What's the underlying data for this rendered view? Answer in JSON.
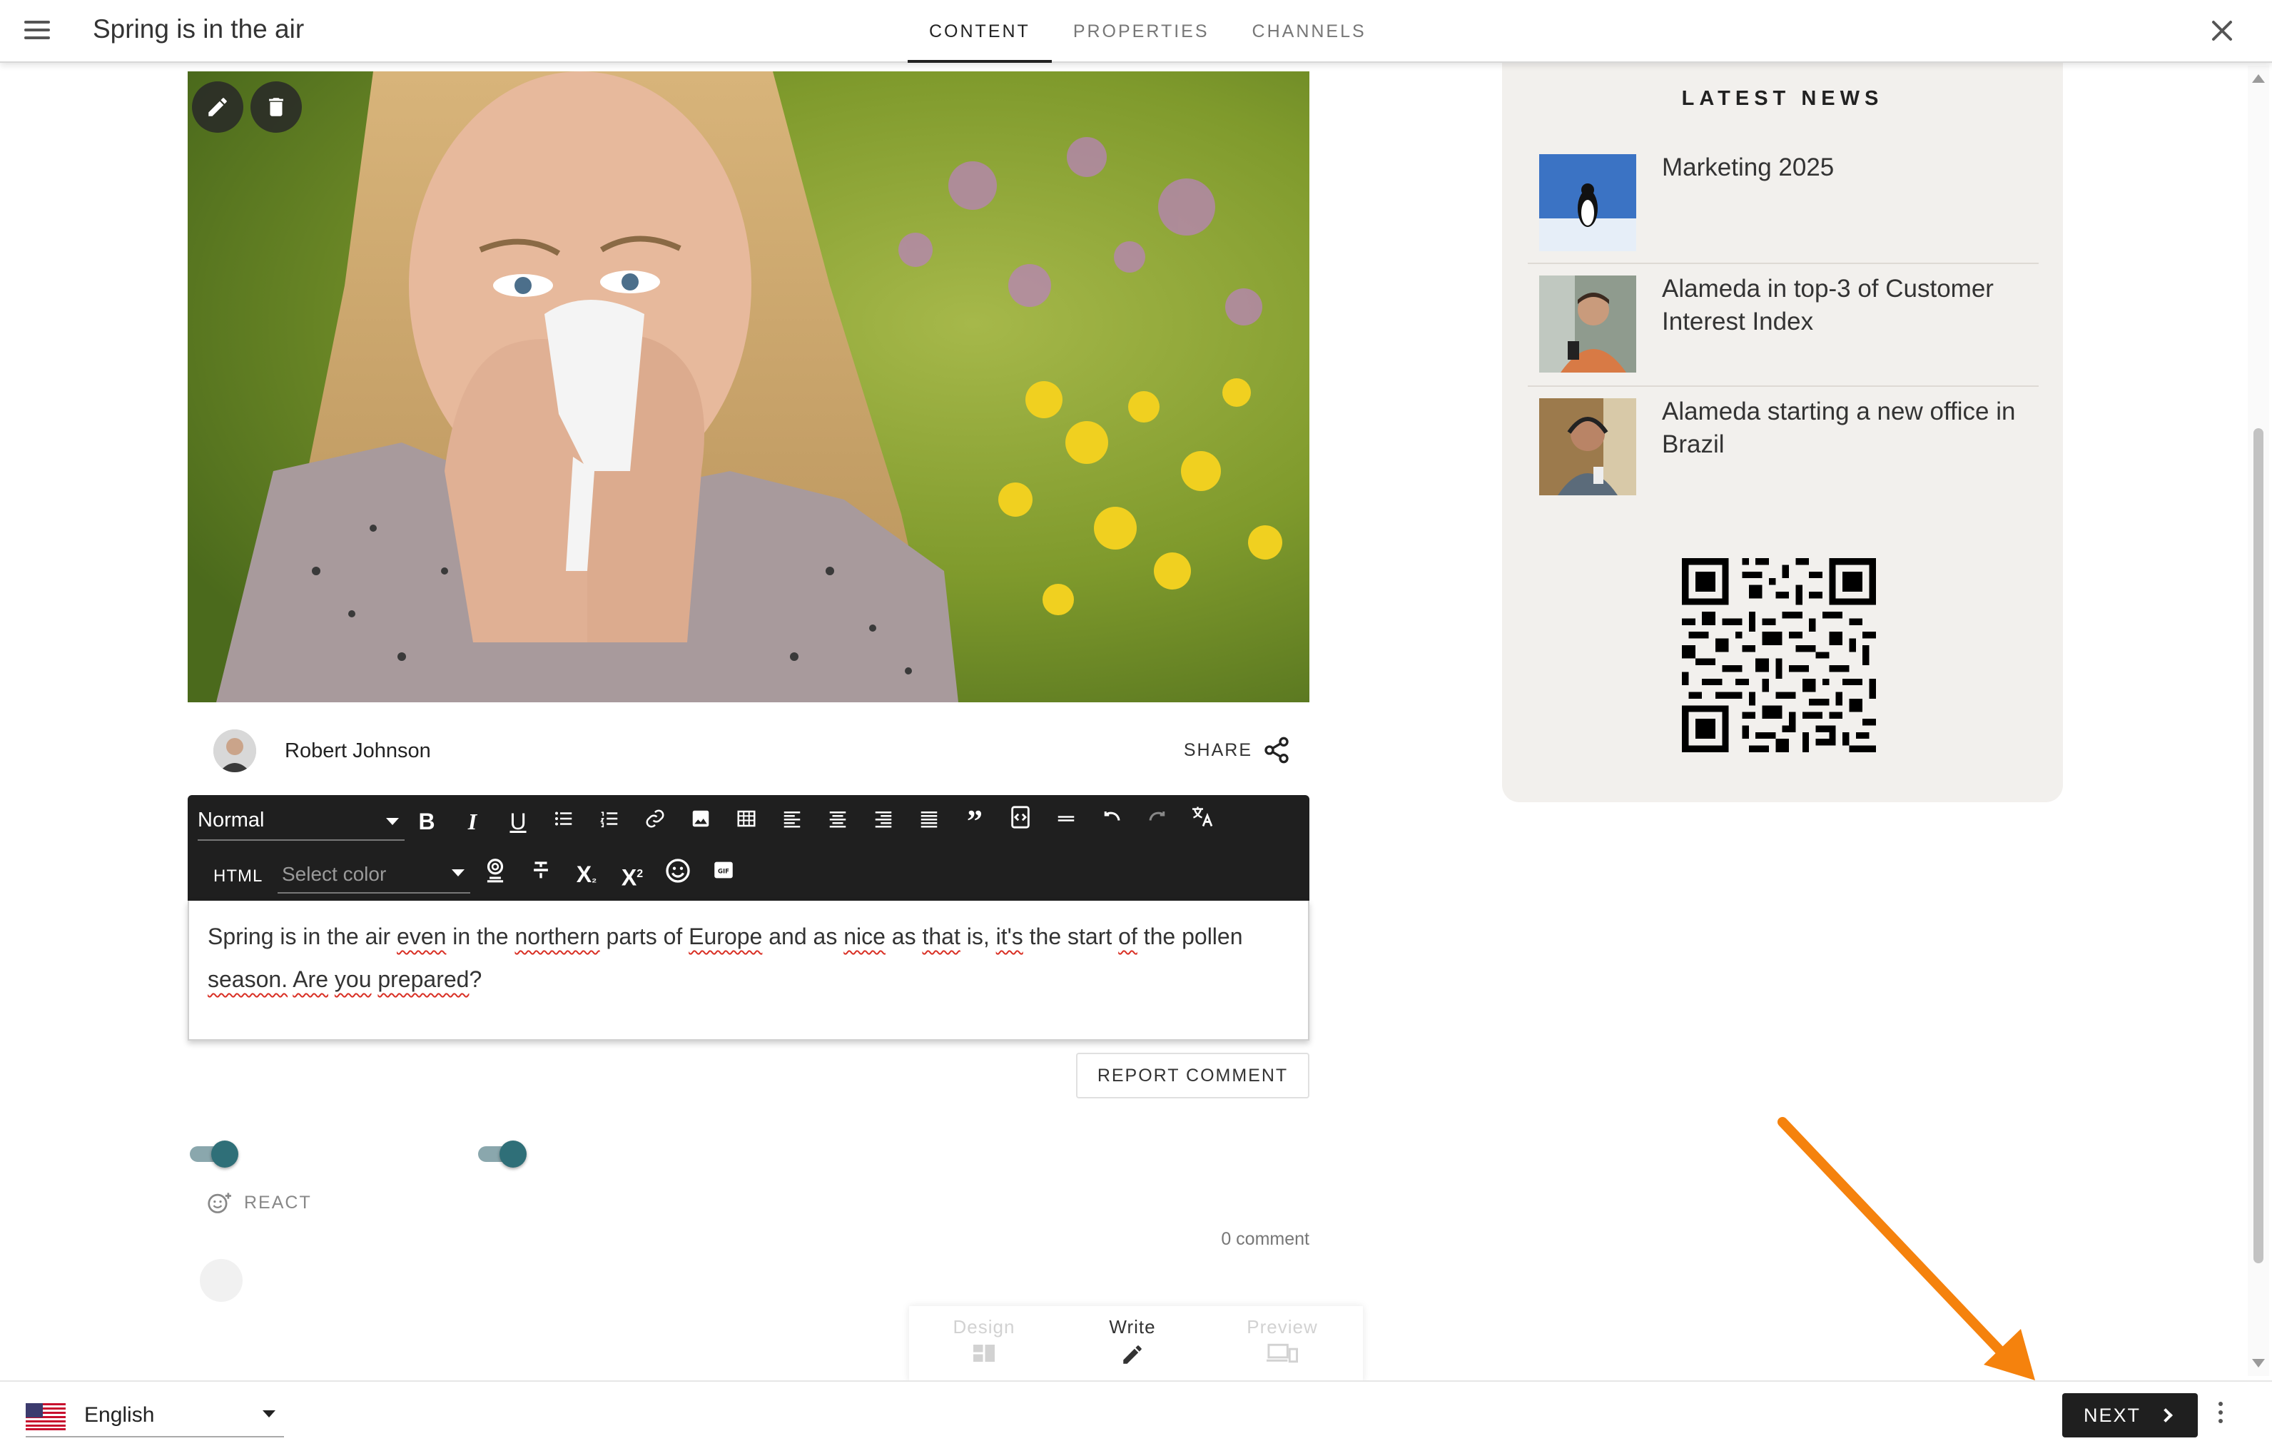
{
  "header": {
    "title": "Spring is in the air",
    "tabs": [
      {
        "label": "CONTENT",
        "active": true
      },
      {
        "label": "PROPERTIES",
        "active": false
      },
      {
        "label": "CHANNELS",
        "active": false
      }
    ]
  },
  "article": {
    "author": "Robert Johnson",
    "share_label": "SHARE",
    "body_text": "Spring is in the air even in the northern parts of Europe and as nice as that is, it's the start of the pollen season.  Are you prepared?",
    "report_label": "REPORT COMMENT",
    "react_label": "REACT",
    "comment_count": "0 comment"
  },
  "editor_toolbar": {
    "format_value": "Normal",
    "html_label": "HTML",
    "color_placeholder": "Select color"
  },
  "modes": [
    {
      "label": "Design",
      "state": "disabled"
    },
    {
      "label": "Write",
      "state": "active"
    },
    {
      "label": "Preview",
      "state": "disabled"
    }
  ],
  "news": {
    "title": "LATEST NEWS",
    "items": [
      {
        "title": "Marketing 2025"
      },
      {
        "title": "Alameda in top-3 of Customer Interest Index"
      },
      {
        "title": "Alameda starting a new office in Brazil"
      }
    ]
  },
  "footer": {
    "language": "English",
    "next_label": "NEXT"
  },
  "colors": {
    "toolbar_bg": "#1f1f1f",
    "toggle_knob": "#2f6f78",
    "news_panel_bg": "#f2f0ed",
    "annotation_arrow": "#f5820d"
  }
}
